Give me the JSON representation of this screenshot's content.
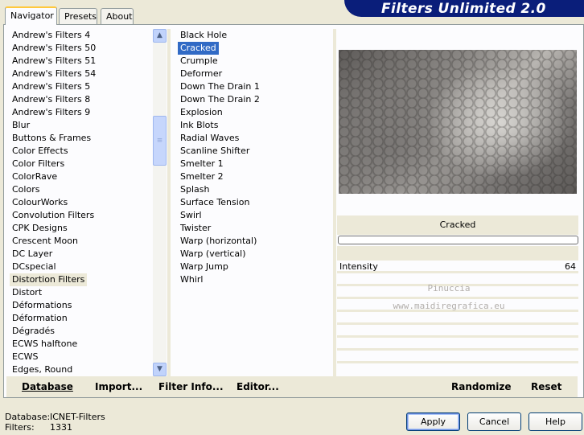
{
  "window": {
    "title": "Filters Unlimited 2.0",
    "tabs": [
      "Navigator",
      "Presets",
      "About"
    ]
  },
  "categories": [
    "Andrew's Filters 4",
    "Andrew's Filters 50",
    "Andrew's Filters 51",
    "Andrew's Filters 54",
    "Andrew's Filters 5",
    "Andrew's Filters 8",
    "Andrew's Filters 9",
    "Blur",
    "Buttons & Frames",
    "Color Effects",
    "Color Filters",
    "ColorRave",
    "Colors",
    "ColourWorks",
    "Convolution Filters",
    "CPK Designs",
    "Crescent Moon",
    "DC Layer",
    "DCspecial",
    "Distortion Filters",
    "Distort",
    "Déformations",
    "Déformation",
    "Dégradés",
    "ECWS halftone",
    "ECWS",
    "Edges, Round"
  ],
  "selected_category": "Distortion Filters",
  "filters": [
    "Black Hole",
    "Cracked",
    "Crumple",
    "Deformer",
    "Down The Drain 1",
    "Down The Drain 2",
    "Explosion",
    "Ink Blots",
    "Radial Waves",
    "Scanline Shifter",
    "Smelter 1",
    "Smelter 2",
    "Splash",
    "Surface Tension",
    "Swirl",
    "Twister",
    "Warp (horizontal)",
    "Warp (vertical)",
    "Warp Jump",
    "Whirl"
  ],
  "selected_filter": "Cracked",
  "preview": {
    "filter_name": "Cracked",
    "progress": 0,
    "watermark": [
      "Pinuccia",
      "www.maidiregrafica.eu"
    ]
  },
  "parameters": [
    {
      "name": "Intensity",
      "value": "64"
    }
  ],
  "toolbar": {
    "database": "Database",
    "import": "Import...",
    "filter_info": "Filter Info...",
    "editor": "Editor...",
    "randomize": "Randomize",
    "reset": "Reset"
  },
  "status": {
    "database_label": "Database:",
    "database_value": "ICNET-Filters",
    "filters_label": "Filters:",
    "filters_value": "1331"
  },
  "buttons": {
    "apply": "Apply",
    "cancel": "Cancel",
    "help": "Help"
  },
  "colors": {
    "selection": "#316ac5",
    "banner": "#0a1e7a",
    "dialog_bg": "#ece9d8"
  }
}
